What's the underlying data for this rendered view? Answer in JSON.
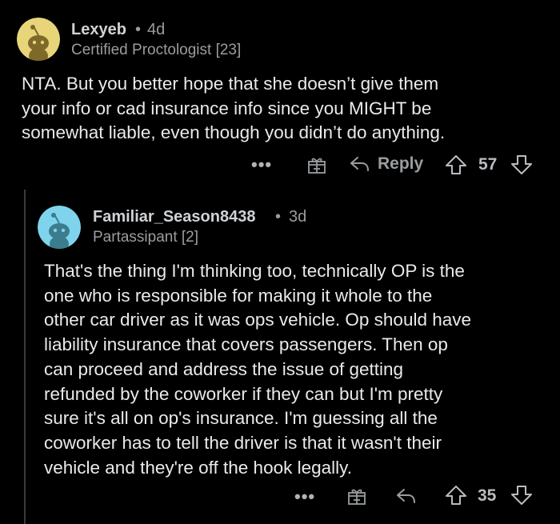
{
  "comments": [
    {
      "username": "Lexyeb",
      "separator": "•",
      "age": "4d",
      "flair": "Certified Proctologist [23]",
      "body_lines": [
        "NTA. But you better hope that she doesn’t give them",
        "your info or cad insurance info since you MIGHT be",
        "somewhat liable, even though you didn’t do anything."
      ],
      "actions": {
        "more": "•••",
        "reply_label": "Reply",
        "score": "57"
      },
      "avatar_bg": "#e8d57a"
    },
    {
      "username": "Familiar_Season8438",
      "separator": "•",
      "age": "3d",
      "flair": "Partassipant [2]",
      "body_lines": [
        "That's the thing I'm thinking too, technically OP is the",
        "one who is responsible for making it whole to the",
        "other car driver as it was ops vehicle. Op should have",
        "liability insurance that covers passengers. Then op",
        "can proceed and address the issue of getting",
        "refunded by the coworker if they can but I'm pretty",
        "sure it's all on op's insurance. I'm guessing all the",
        "coworker has to tell the driver is that it wasn't their",
        "vehicle and they're off the hook legally."
      ],
      "actions": {
        "more": "•••",
        "score": "35"
      },
      "avatar_bg": "#7fd3ec"
    }
  ],
  "icons": [
    "snoo-avatar-icon",
    "more-options-icon",
    "award-gift-icon",
    "reply-arrow-icon",
    "upvote-arrow-icon",
    "downvote-arrow-icon"
  ],
  "colors": {
    "background": "#000000",
    "text_primary": "#e8eaec",
    "text_secondary": "#9a9da0",
    "thread_line": "#3a3a3c"
  }
}
